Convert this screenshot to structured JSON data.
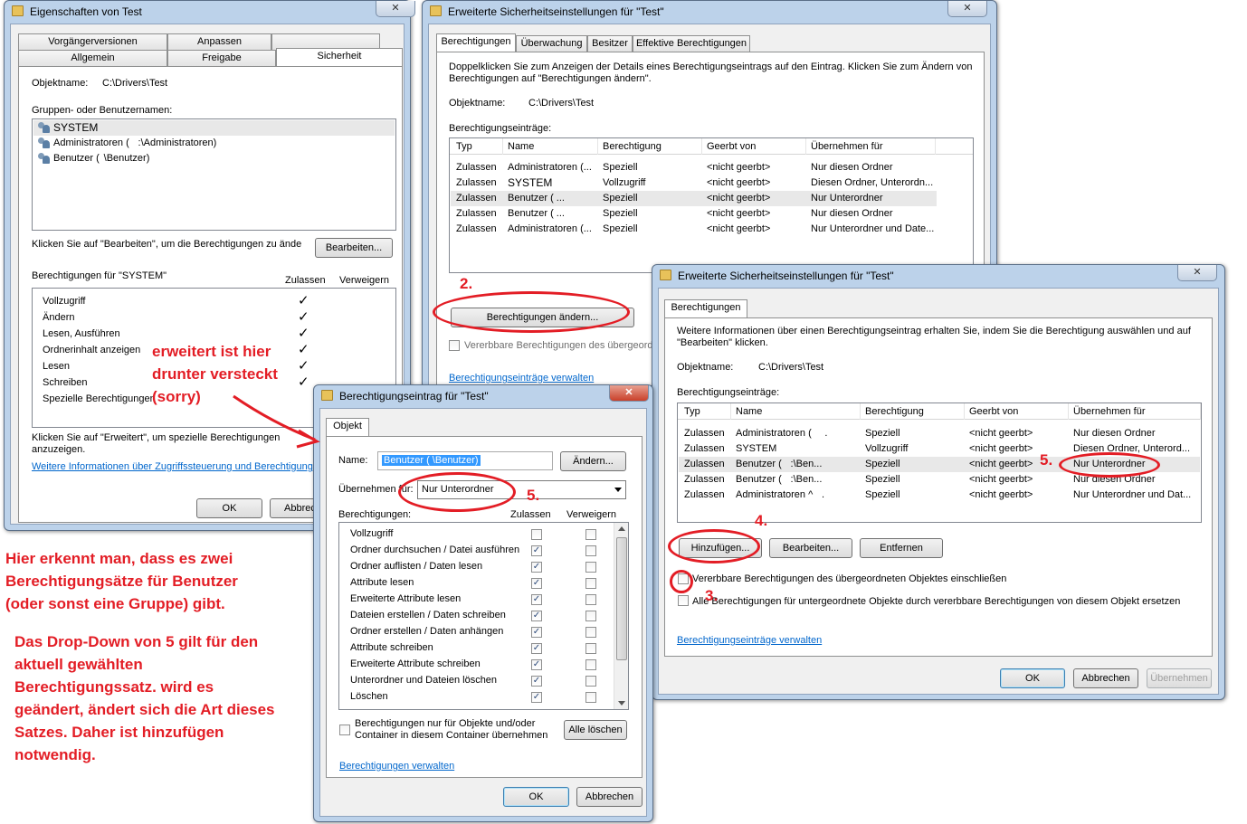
{
  "props": {
    "title": "Eigenschaften von Test",
    "tabs_row1": [
      "Vorgängerversionen",
      "Anpassen"
    ],
    "tabs_row2": [
      "Allgemein",
      "Freigabe",
      "Sicherheit"
    ],
    "object_label": "Objektname:",
    "object_value": "C:\\Drivers\\Test",
    "groups_label": "Gruppen- oder Benutzernamen:",
    "groups": [
      "SYSTEM",
      "Administratoren (       :\\Administratoren)",
      "Benutzer (        \\Benutzer)"
    ],
    "edit_hint": "Klicken Sie auf \"Bearbeiten\", um die Berechtigungen zu ände",
    "edit_button": "Bearbeiten...",
    "perms_for": "Berechtigungen für \"SYSTEM\"",
    "allow_col": "Zulassen",
    "deny_col": "Verweigern",
    "perms": [
      "Vollzugriff",
      "Ändern",
      "Lesen, Ausführen",
      "Ordnerinhalt anzeigen",
      "Lesen",
      "Schreiben",
      "Spezielle Berechtigungen"
    ],
    "check_glyph": "✓",
    "adv_hint_1": "Klicken Sie auf \"Erweitert\", um spezielle Berechtigungen",
    "adv_hint_2": "anzuzeigen.",
    "more_info_link": "Weitere Informationen über Zugriffssteuerung und Berechtigungen",
    "ok": "OK",
    "cancel": "Abbrech"
  },
  "adv1": {
    "title": "Erweiterte Sicherheitseinstellungen für \"Test\"",
    "tabs": [
      "Berechtigungen",
      "Überwachung",
      "Besitzer",
      "Effektive Berechtigungen"
    ],
    "hint_1": "Doppelklicken Sie zum Anzeigen der Details eines Berechtigungseintrags auf den Eintrag. Klicken Sie zum Ändern von",
    "hint_2": "Berechtigungen auf \"Berechtigungen ändern\".",
    "object_label": "Objektname:",
    "object_value": "C:\\Drivers\\Test",
    "entries_label": "Berechtigungseinträge:",
    "columns": [
      "Typ",
      "Name",
      "Berechtigung",
      "Geerbt von",
      "Übernehmen für"
    ],
    "rows": [
      [
        "Zulassen",
        "Administratoren (...",
        "Speziell",
        "<nicht geerbt>",
        "Nur diesen Ordner"
      ],
      [
        "Zulassen",
        "SYSTEM",
        "Vollzugriff",
        "<nicht geerbt>",
        "Diesen Ordner, Unterordn..."
      ],
      [
        "Zulassen",
        "Benutzer (          ...",
        "Speziell",
        "<nicht geerbt>",
        "Nur Unterordner"
      ],
      [
        "Zulassen",
        "Benutzer (          ...",
        "Speziell",
        "<nicht geerbt>",
        "Nur diesen Ordner"
      ],
      [
        "Zulassen",
        "Administratoren (...",
        "Speziell",
        "<nicht geerbt>",
        "Nur Unterordner und Date..."
      ]
    ],
    "change_button": "Berechtigungen ändern...",
    "inherit_checkbox": "Vererbbare Berechtigungen des übergeordnet",
    "manage_link": "Berechtigungseinträge verwalten"
  },
  "adv2": {
    "title": "Erweiterte Sicherheitseinstellungen für \"Test\"",
    "tab": "Berechtigungen",
    "hint_1": "Weitere Informationen über einen Berechtigungseintrag erhalten Sie, indem Sie die Berechtigung auswählen und auf",
    "hint_2": "\"Bearbeiten\" klicken.",
    "object_label": "Objektname:",
    "object_value": "C:\\Drivers\\Test",
    "entries_label": "Berechtigungseinträge:",
    "columns": [
      "Typ",
      "Name",
      "Berechtigung",
      "Geerbt von",
      "Übernehmen für"
    ],
    "rows": [
      [
        "Zulassen",
        "Administratoren (          .",
        "Speziell",
        "<nicht geerbt>",
        "Nur diesen Ordner"
      ],
      [
        "Zulassen",
        "SYSTEM",
        "Vollzugriff",
        "<nicht geerbt>",
        "Diesen Ordner, Unterord..."
      ],
      [
        "Zulassen",
        "Benutzer (      :\\Ben...",
        "Speziell",
        "<nicht geerbt>",
        "Nur Unterordner"
      ],
      [
        "Zulassen",
        "Benutzer (      :\\Ben...",
        "Speziell",
        "<nicht geerbt>",
        "Nur diesen Ordner"
      ],
      [
        "Zulassen",
        "Administratoren ^       .",
        "Speziell",
        "<nicht geerbt>",
        "Nur Unterordner und Dat..."
      ]
    ],
    "add_button": "Hinzufügen...",
    "edit_button": "Bearbeiten...",
    "remove_button": "Entfernen",
    "inherit_checkbox": "Vererbbare Berechtigungen des übergeordneten Objektes einschließen",
    "replace_checkbox": "Alle Berechtigungen für untergeordnete Objekte durch vererbbare Berechtigungen von diesem Objekt ersetzen",
    "manage_link": "Berechtigungseinträge verwalten",
    "ok": "OK",
    "cancel": "Abbrechen",
    "apply": "Übernehmen"
  },
  "entry": {
    "title": "Berechtigungseintrag für \"Test\"",
    "tab": "Objekt",
    "name_label": "Name:",
    "name_value": "Benutzer (          \\Benutzer)",
    "change_button": "Ändern...",
    "apply_label": "Übernehmen für:",
    "apply_value": "Nur Unterordner",
    "perms_label": "Berechtigungen:",
    "allow_col": "Zulassen",
    "deny_col": "Verweigern",
    "perms": [
      "Vollzugriff",
      "Ordner durchsuchen / Datei ausführen",
      "Ordner auflisten / Daten lesen",
      "Attribute lesen",
      "Erweiterte Attribute lesen",
      "Dateien erstellen / Daten schreiben",
      "Ordner erstellen / Daten anhängen",
      "Attribute schreiben",
      "Erweiterte Attribute schreiben",
      "Unterordner und Dateien löschen",
      "Löschen"
    ],
    "allow_checked": [
      false,
      true,
      true,
      true,
      true,
      true,
      true,
      true,
      true,
      true,
      true
    ],
    "only_container_1": "Berechtigungen nur für Objekte und/oder",
    "only_container_2": "Container in diesem Container übernehmen",
    "clear_all": "Alle löschen",
    "manage_link": "Berechtigungen verwalten",
    "ok": "OK",
    "cancel": "Abbrechen"
  },
  "annotations": {
    "hidden_1": "erweitert ist hier",
    "hidden_2": "drunter versteckt",
    "hidden_3": "(sorry)",
    "n2": "2.",
    "n3": "3.",
    "n4": "4.",
    "n5a": "5.",
    "n5b": "5.",
    "note1": [
      "Hier erkennt man, dass es zwei",
      "Berechtigungsätze für Benutzer",
      "(oder sonst eine Gruppe) gibt."
    ],
    "note2": [
      "Das Drop-Down von 5 gilt für den",
      "aktuell gewählten",
      "Berechtigungssatz. wird es",
      "geändert, ändert sich die Art dieses",
      "Satzes. Daher ist hinzufügen",
      "notwendig."
    ]
  }
}
